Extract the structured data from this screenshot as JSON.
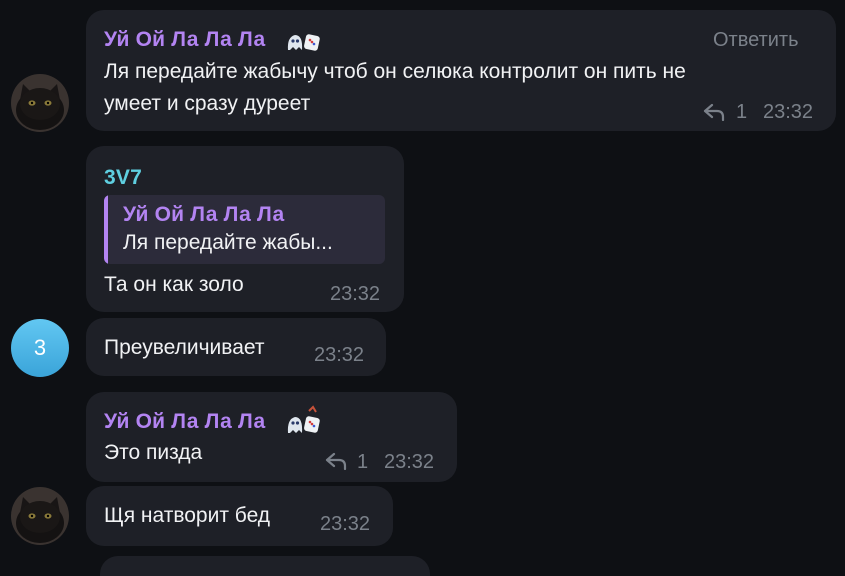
{
  "colors": {
    "background": "#0e1014",
    "bubble": "#1e2027",
    "sender_purple": "#b384f2",
    "sender_cyan": "#5fcfe0",
    "meta_gray": "#7b818a",
    "quote_bg": "#2c2b3a",
    "avatar_letter_bg": "#4db6e6"
  },
  "messages": [
    {
      "sender": "Уй Ой Ла Ла Ла",
      "sender_emoji": "ghost-dice-emoji",
      "reply_action": "Ответить",
      "text_line1": "Ля передайте жабычу чтоб он селюка контролит он пить не",
      "text_line2": "умеет и сразу дуреет",
      "reply_count": "1",
      "time": "23:32"
    },
    {
      "sender": "3V7",
      "quote_sender": "Уй Ой Ла Ла Ла",
      "quote_text": "Ля передайте жабы...",
      "text": "Та он как золо",
      "time": "23:32"
    },
    {
      "avatar_letter": "3",
      "text": "Преувеличивает",
      "time": "23:32"
    },
    {
      "sender": "Уй Ой Ла Ла Ла",
      "sender_emoji": "ghost-dice-emoji",
      "text": "Это пизда",
      "reply_count": "1",
      "time": "23:32"
    },
    {
      "text": "Щя натворит бед",
      "time": "23:32"
    }
  ]
}
